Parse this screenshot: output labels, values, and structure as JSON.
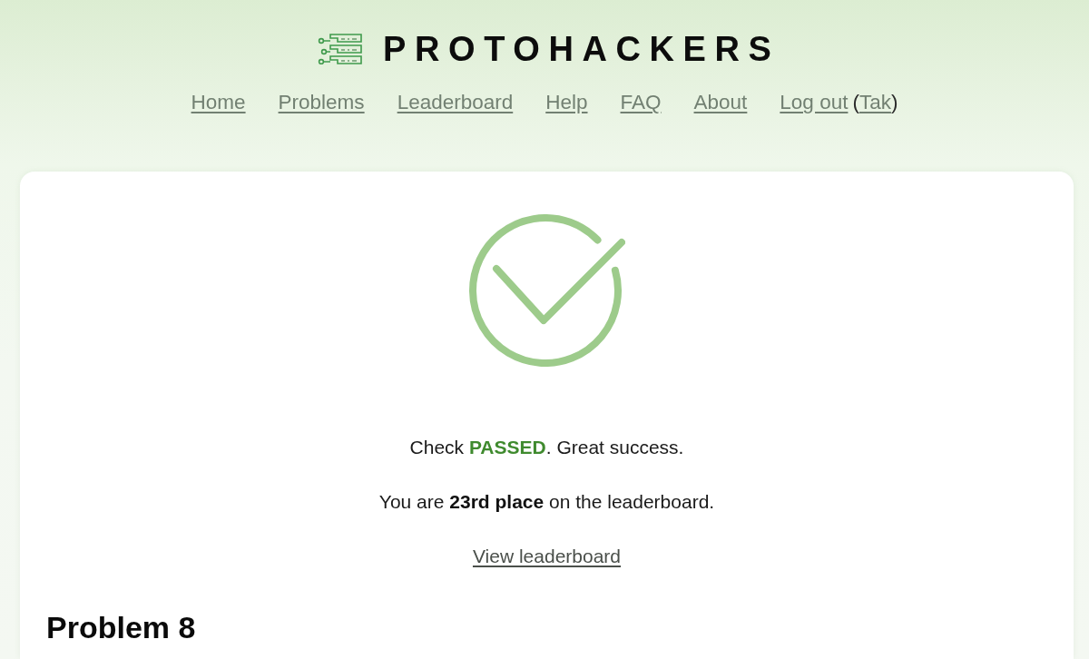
{
  "header": {
    "logo_text": "PROTOHACKERS"
  },
  "nav": {
    "links": [
      {
        "label": "Home"
      },
      {
        "label": "Problems"
      },
      {
        "label": "Leaderboard"
      },
      {
        "label": "Help"
      },
      {
        "label": "FAQ"
      },
      {
        "label": "About"
      },
      {
        "label": "Log out"
      }
    ],
    "user": {
      "before": "(",
      "name": "Tak",
      "after": ")"
    }
  },
  "result": {
    "messages": [
      {
        "kind": "status",
        "text": "Check **PASSED**. Great success."
      },
      {
        "kind": "rank",
        "text": "You are **23rd place** on the leaderboard."
      }
    ],
    "link": "View leaderboard"
  },
  "problem": {
    "heading": "Problem 8"
  }
}
